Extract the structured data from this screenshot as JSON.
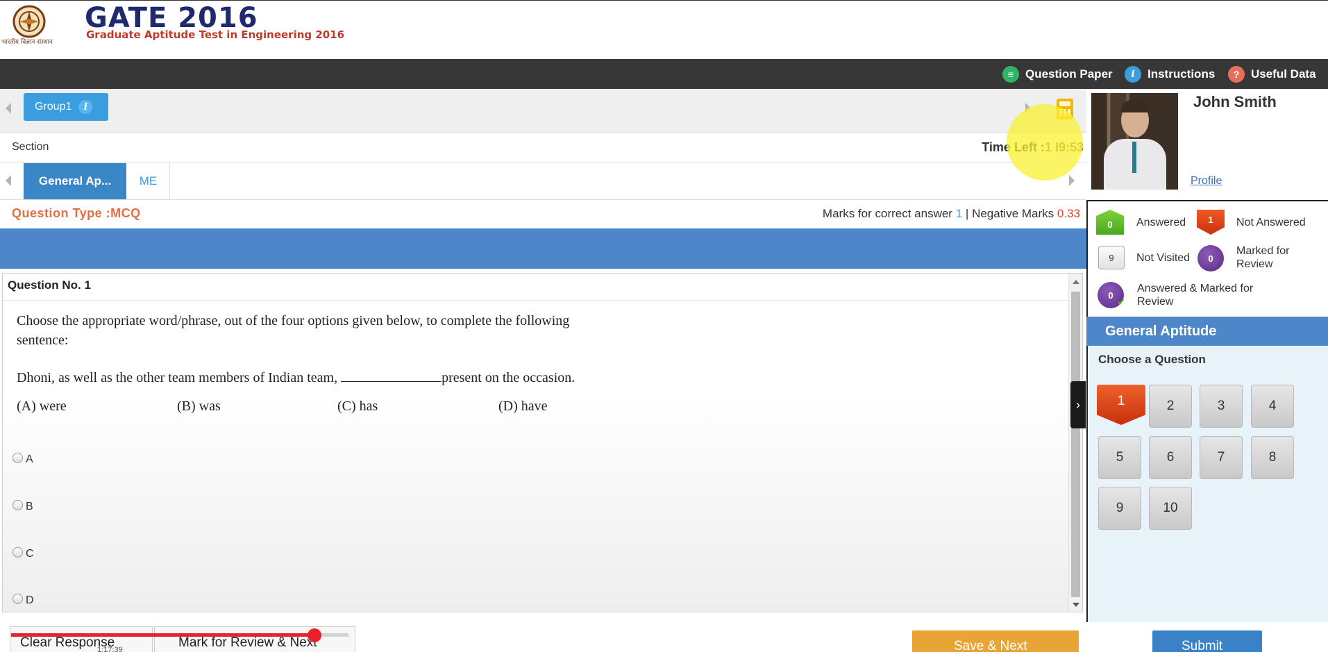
{
  "header": {
    "emblem_caption": "भारतीय विज्ञान संस्थान",
    "brand_title": "GATE 2016",
    "brand_subtitle": "Graduate Aptitude Test in Engineering 2016"
  },
  "menu": {
    "question_paper": "Question Paper",
    "instructions": "Instructions",
    "useful_data": "Useful Data",
    "colors": {
      "question_paper": "#2fb565",
      "instructions": "#3a9ddd",
      "useful_data": "#e8705a"
    }
  },
  "group": {
    "label": "Group1",
    "info_glyph": "i"
  },
  "section": {
    "label": "Section",
    "time_label": "Time Left :",
    "time_value": "1",
    "time_value_tail": "9:53",
    "tabs": [
      "General Ap...",
      "ME"
    ]
  },
  "question_meta": {
    "type_label": "Question Type :MCQ",
    "marks_prefix": "Marks for correct answer",
    "marks_value": "1",
    "separator": "|",
    "negative_prefix": "Negative Marks",
    "negative_value": "0.33"
  },
  "question": {
    "number_label": "Question No. 1",
    "stem_line1": "Choose the appropriate word/phrase, out of the four options given below, to complete the following",
    "stem_line2": "sentence:",
    "sentence_before": "Dhoni, as well as the other team members of Indian team,",
    "sentence_after": "present on the occasion.",
    "options": [
      {
        "tag": "(A)",
        "text": "were"
      },
      {
        "tag": "(B)",
        "text": "was"
      },
      {
        "tag": "(C)",
        "text": "has"
      },
      {
        "tag": "(D)",
        "text": "have"
      }
    ],
    "radio_labels": [
      "A",
      "B",
      "C",
      "D"
    ]
  },
  "bottom": {
    "clear_response": "Clear Response",
    "mark_review_next": "Mark for Review & Next",
    "save_next": "Save & Next",
    "submit": "Submit",
    "video_time": "1:17:39",
    "video_progress": 0.9
  },
  "profile": {
    "name": "John Smith",
    "profile_link": "Profile"
  },
  "legend": {
    "answered": {
      "count": "0",
      "label": "Answered"
    },
    "not_answered": {
      "count": "1",
      "label": "Not Answered"
    },
    "not_visited": {
      "count": "9",
      "label": "Not Visited"
    },
    "marked_review": {
      "count": "0",
      "label": "Marked for Review"
    },
    "answered_marked": {
      "count": "0",
      "label": "Answered & Marked for Review"
    }
  },
  "palette": {
    "section_title": "General Aptitude",
    "choose_label": "Choose a Question",
    "questions": [
      "1",
      "2",
      "3",
      "4",
      "5",
      "6",
      "7",
      "8",
      "9",
      "10"
    ],
    "current_status": "not-answered"
  }
}
